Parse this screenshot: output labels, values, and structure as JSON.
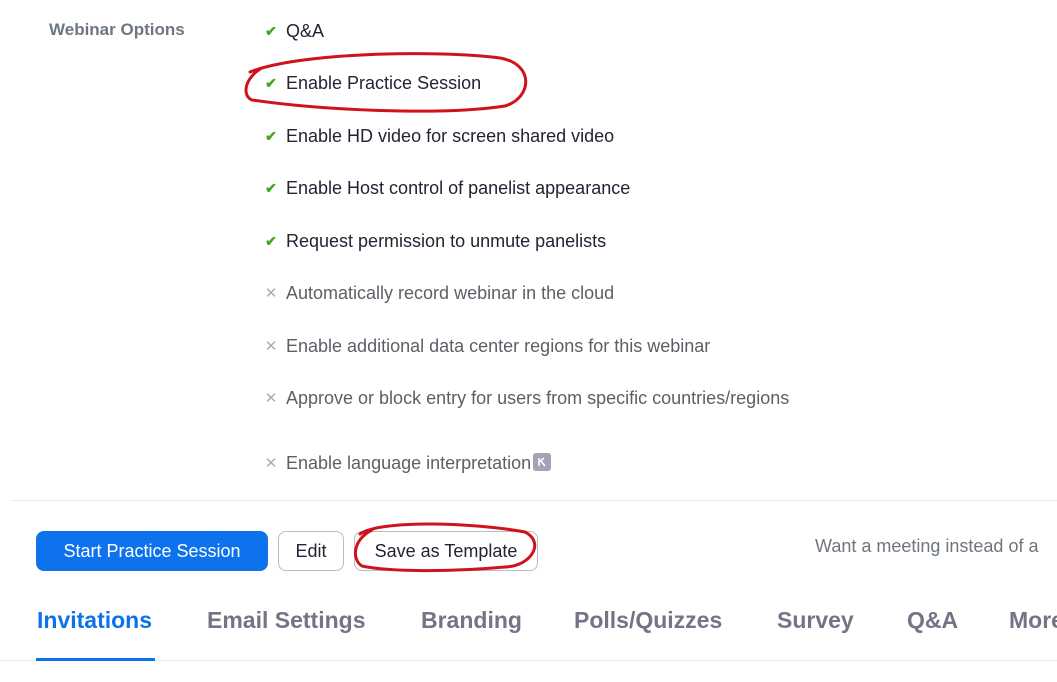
{
  "webinar_options": {
    "label": "Webinar Options",
    "items": [
      {
        "label": "Q&A",
        "enabled": true,
        "icon": "check-icon"
      },
      {
        "label": "Enable Practice Session",
        "enabled": true,
        "icon": "check-icon"
      },
      {
        "label": "Enable HD video for screen shared video",
        "enabled": true,
        "icon": "check-icon"
      },
      {
        "label": "Enable Host control of panelist appearance",
        "enabled": true,
        "icon": "check-icon"
      },
      {
        "label": "Request permission to unmute panelists",
        "enabled": true,
        "icon": "check-icon"
      },
      {
        "label": "Automatically record webinar in the cloud",
        "enabled": false,
        "icon": "x-icon"
      },
      {
        "label": "Enable additional data center regions for this webinar",
        "enabled": false,
        "icon": "x-icon"
      },
      {
        "label": "Approve or block entry for users from specific countries/regions",
        "enabled": false,
        "icon": "x-icon"
      },
      {
        "label": "Enable language interpretation",
        "enabled": false,
        "icon": "x-icon",
        "badge_icon": "interpretation-icon"
      }
    ],
    "check_glyph": "✔",
    "x_glyph": "✕"
  },
  "actions": {
    "start_practice_label": "Start Practice Session",
    "edit_label": "Edit",
    "save_template_label": "Save as Template",
    "meeting_link_text": "Want a meeting instead of a"
  },
  "tabs": [
    {
      "label": "Invitations",
      "active": true
    },
    {
      "label": "Email Settings",
      "active": false
    },
    {
      "label": "Branding",
      "active": false
    },
    {
      "label": "Polls/Quizzes",
      "active": false
    },
    {
      "label": "Survey",
      "active": false
    },
    {
      "label": "Q&A",
      "active": false
    },
    {
      "label": "More",
      "active": false
    }
  ],
  "colors": {
    "accent": "#0e72ed",
    "check": "#43a51a",
    "x_mark": "#a9adb3",
    "annotation": "#d0121b"
  }
}
